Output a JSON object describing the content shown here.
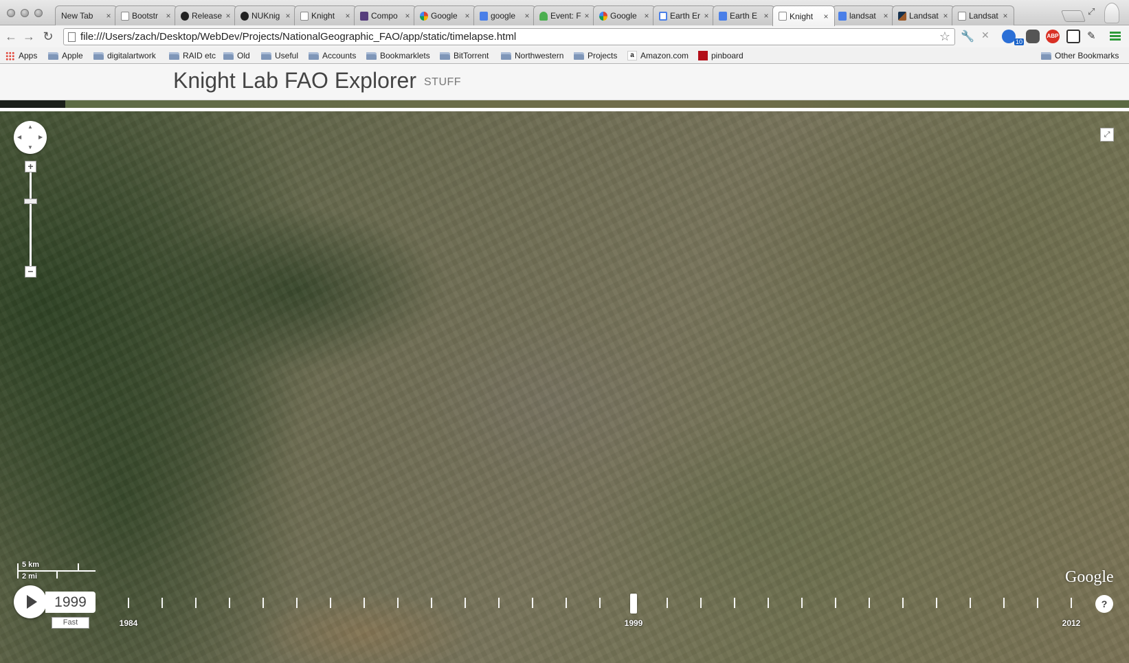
{
  "browser": {
    "tabs": [
      {
        "label": "New Tab",
        "icon": "none-icon"
      },
      {
        "label": "Bootstr",
        "icon": "document-icon"
      },
      {
        "label": "Release",
        "icon": "github-icon"
      },
      {
        "label": "NUKnig",
        "icon": "github-icon"
      },
      {
        "label": "Knight",
        "icon": "document-icon"
      },
      {
        "label": "Compo",
        "icon": "bootstrap-icon"
      },
      {
        "label": "Google",
        "icon": "google-icon"
      },
      {
        "label": "google",
        "icon": "google-search-icon"
      },
      {
        "label": "Event: F",
        "icon": "event-icon"
      },
      {
        "label": "Google",
        "icon": "google-icon"
      },
      {
        "label": "Earth Er",
        "icon": "earth-engine-icon"
      },
      {
        "label": "Earth E",
        "icon": "google-search-icon"
      },
      {
        "label": "Knight",
        "icon": "document-icon",
        "active": true
      },
      {
        "label": "landsat",
        "icon": "google-search-icon"
      },
      {
        "label": "Landsat",
        "icon": "landsat-icon"
      },
      {
        "label": "Landsat",
        "icon": "document-icon"
      }
    ],
    "close_glyph": "×",
    "url": "file:///Users/zach/Desktop/WebDev/Projects/NationalGeographic_FAO/app/static/timelapse.html",
    "extension_badge": "10",
    "adblock_label": "ABP",
    "bookmarks": [
      {
        "label": "Apps",
        "type": "apps"
      },
      {
        "label": "Apple",
        "type": "folder"
      },
      {
        "label": "digitalartwork",
        "type": "folder"
      },
      {
        "label": "RAID etc",
        "type": "folder"
      },
      {
        "label": "Old",
        "type": "folder"
      },
      {
        "label": "Useful",
        "type": "folder"
      },
      {
        "label": "Accounts",
        "type": "folder"
      },
      {
        "label": "Bookmarklets",
        "type": "folder"
      },
      {
        "label": "BitTorrent",
        "type": "folder"
      },
      {
        "label": "Northwestern",
        "type": "folder"
      },
      {
        "label": "Projects",
        "type": "folder"
      },
      {
        "label": "Amazon.com",
        "type": "amazon"
      },
      {
        "label": "pinboard",
        "type": "pinboard"
      }
    ],
    "other_bookmarks": "Other Bookmarks"
  },
  "page": {
    "title": "Knight Lab FAO Explorer",
    "subtitle": "STUFF"
  },
  "map": {
    "zoom_in": "+",
    "zoom_out": "−",
    "fullscreen_glyph": "⤢",
    "scale_km": "5 km",
    "scale_mi": "2 mi",
    "logo": "Google",
    "zoom_level_fraction": 0.31
  },
  "timelapse": {
    "current_year": "1999",
    "speed_label": "Fast",
    "year_start": 1984,
    "year_end": 2012,
    "tick_count": 29,
    "labels": [
      "1984",
      "1999",
      "2012"
    ],
    "help_label": "?"
  }
}
